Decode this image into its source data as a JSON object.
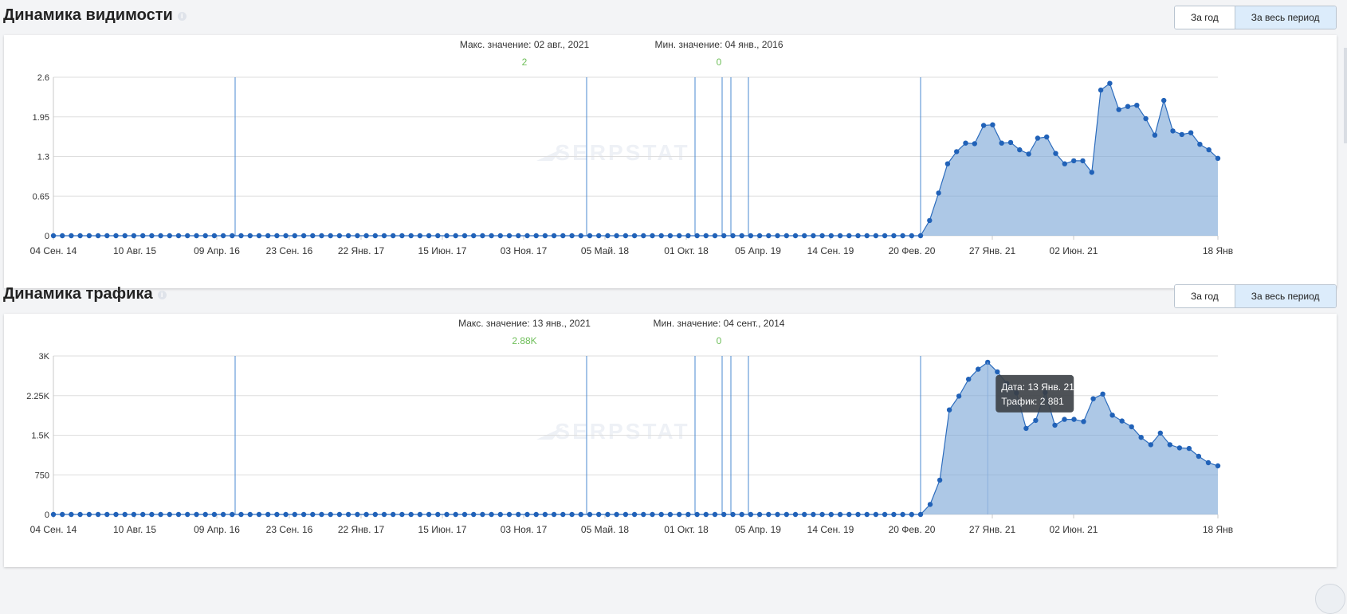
{
  "sections": [
    {
      "title": "Динамика видимости",
      "buttons": [
        "За год",
        "За весь период"
      ],
      "active_button": 1,
      "max_label": "Макс. значение: 02 авг., 2021",
      "max_value": "2",
      "min_label": "Мин. значение: 04 янв., 2016",
      "min_value": "0",
      "watermark": "SERPSTAT"
    },
    {
      "title": "Динамика трафика",
      "buttons": [
        "За год",
        "За весь период"
      ],
      "active_button": 1,
      "max_label": "Макс. значение: 13 янв., 2021",
      "max_value": "2.88K",
      "min_label": "Мин. значение: 04 сент., 2014",
      "min_value": "0",
      "watermark": "SERPSTAT",
      "tooltip": {
        "line1": "Дата: 13 Янв. 21",
        "line2": "Трафик: 2 881"
      }
    }
  ],
  "chart_data": [
    {
      "type": "area",
      "title": "Динамика видимости",
      "x_range": [
        "2014-09-04",
        "2022-01-18"
      ],
      "x_ticks": [
        "04 Сен. 14",
        "10 Авг. 15",
        "09 Апр. 16",
        "23 Сен. 16",
        "22 Янв. 17",
        "15 Июн. 17",
        "03 Ноя. 17",
        "05 Май. 18",
        "01 Окт. 18",
        "05 Апр. 19",
        "14 Сен. 19",
        "20 Фев. 20",
        "27 Янв. 21",
        "02 Июн. 21",
        "18 Янв"
      ],
      "y_ticks": [
        "0",
        "0.65",
        "1.3",
        "1.95",
        "2.6"
      ],
      "ylim": [
        0,
        2.6
      ],
      "zero_points_before_rise": 97,
      "values": [
        0,
        0.25,
        0.7,
        1.18,
        1.38,
        1.52,
        1.51,
        1.81,
        1.82,
        1.52,
        1.53,
        1.41,
        1.34,
        1.6,
        1.62,
        1.35,
        1.18,
        1.23,
        1.23,
        1.04,
        2.39,
        2.5,
        2.07,
        2.12,
        2.14,
        1.92,
        1.65,
        2.22,
        1.72,
        1.66,
        1.69,
        1.5,
        1.41,
        1.27
      ],
      "event_markers": [
        "2016-04-09",
        "2018-04-20",
        "2018-09-25",
        "2019-01-10",
        "2019-02-10",
        "2019-03-20",
        "2020-02-20"
      ]
    },
    {
      "type": "area",
      "title": "Динамика трафика",
      "x_range": [
        "2014-09-04",
        "2022-01-18"
      ],
      "x_ticks": [
        "04 Сен. 14",
        "10 Авг. 15",
        "09 Апр. 16",
        "23 Сен. 16",
        "22 Янв. 17",
        "15 Июн. 17",
        "03 Ноя. 17",
        "05 Май. 18",
        "01 Окт. 18",
        "05 Апр. 19",
        "14 Сен. 19",
        "20 Фев. 20",
        "27 Янв. 21",
        "02 Июн. 21",
        "18 Янв"
      ],
      "y_ticks": [
        "0",
        "750",
        "1.5K",
        "2.25K",
        "3K"
      ],
      "ylim": [
        0,
        3000
      ],
      "zero_points_before_rise": 97,
      "values": [
        0,
        190,
        650,
        1980,
        2240,
        2560,
        2750,
        2881,
        2700,
        2480,
        2300,
        1630,
        1780,
        2310,
        1690,
        1800,
        1800,
        1760,
        2190,
        2280,
        1880,
        1770,
        1660,
        1460,
        1320,
        1540,
        1320,
        1260,
        1250,
        1100,
        980,
        920
      ],
      "event_markers": [
        "2016-04-09",
        "2018-04-20",
        "2018-09-25",
        "2019-01-10",
        "2019-02-10",
        "2019-03-20",
        "2020-02-20"
      ],
      "highlight_index": 7
    }
  ]
}
